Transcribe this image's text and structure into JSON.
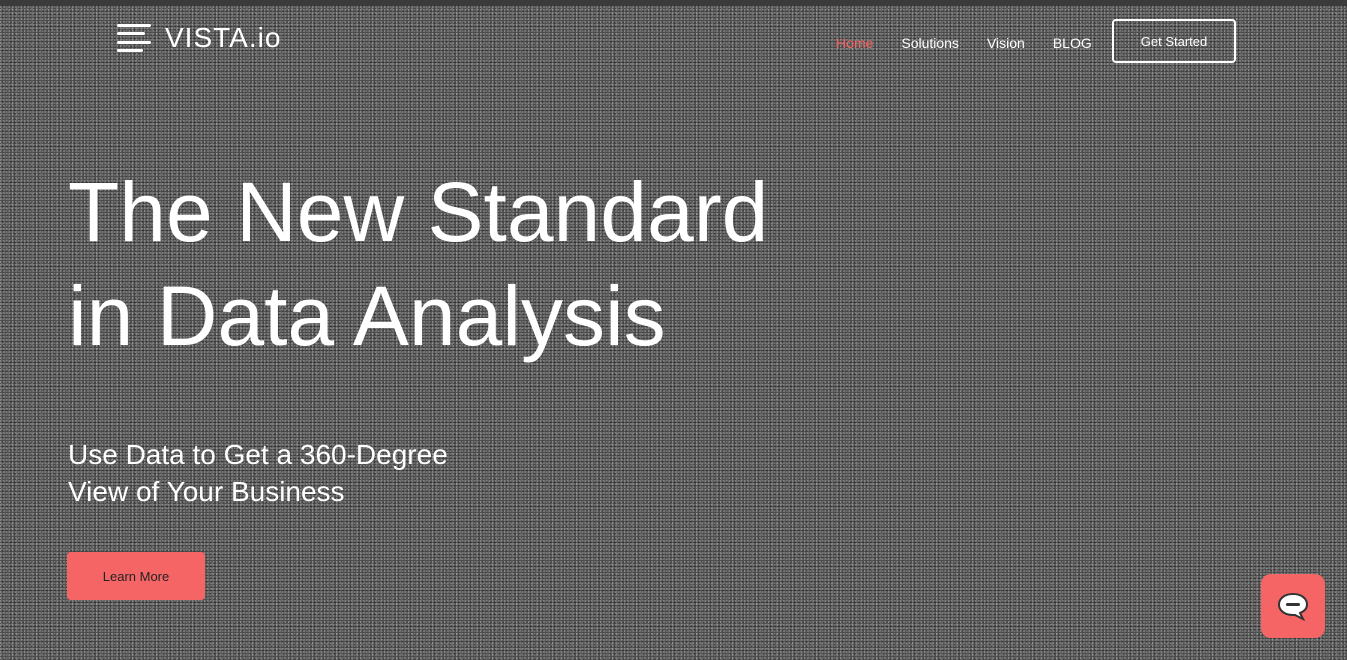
{
  "brand": {
    "name": "VISTA.io",
    "icon": "menu-bars-icon"
  },
  "nav": {
    "items": [
      "Home",
      "Solutions",
      "Vision",
      "BLOG"
    ],
    "cta": "Get Started",
    "active_index": 0
  },
  "hero": {
    "title_lines": [
      "The New Standard",
      "in Data Analysis"
    ],
    "subtitle_lines": [
      "Use Data to Get a 360-Degree",
      "View of Your Business"
    ],
    "button_label": "Learn More"
  },
  "chat": {
    "icon": "chat-bubble-icon"
  },
  "colors": {
    "accent": "#f56565",
    "text": "#ffffff",
    "background": "#5a5a5a"
  }
}
